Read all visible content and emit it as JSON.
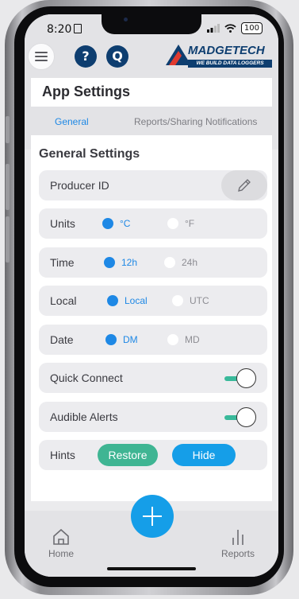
{
  "status": {
    "time": "8:20",
    "battery": "100"
  },
  "header": {
    "help_icon_label": "?",
    "search_icon_label": "Q",
    "logo": {
      "name": "MADGETECH",
      "tagline": "WE BUILD DATA LOGGERS"
    }
  },
  "page": {
    "title": "App Settings"
  },
  "tabs": [
    {
      "label": "General"
    },
    {
      "label": "Reports/Sharing"
    },
    {
      "label": "Notifications"
    }
  ],
  "settings": {
    "section_title": "General Settings",
    "producer_id": {
      "label": "Producer ID"
    },
    "units": {
      "label": "Units",
      "option_a": "°C",
      "option_b": "°F",
      "selected": "°C"
    },
    "time": {
      "label": "Time",
      "option_a": "12h",
      "option_b": "24h",
      "selected": "12h"
    },
    "local": {
      "label": "Local",
      "option_a": "Local",
      "option_b": "UTC",
      "selected": "Local"
    },
    "date": {
      "label": "Date",
      "option_a": "DM",
      "option_b": "MD",
      "selected": "DM"
    },
    "quick_connect": {
      "label": "Quick Connect",
      "enabled": true
    },
    "audible_alerts": {
      "label": "Audible Alerts",
      "enabled": true
    },
    "hints": {
      "label": "Hints",
      "restore_label": "Restore",
      "hide_label": "Hide"
    }
  },
  "bottom_nav": {
    "home_label": "Home",
    "reports_label": "Reports"
  },
  "colors": {
    "accent": "#1e88e5",
    "brand": "#0e3e70",
    "teal": "#39b99a",
    "fab": "#159ee8",
    "logo_red": "#e03a2f"
  }
}
